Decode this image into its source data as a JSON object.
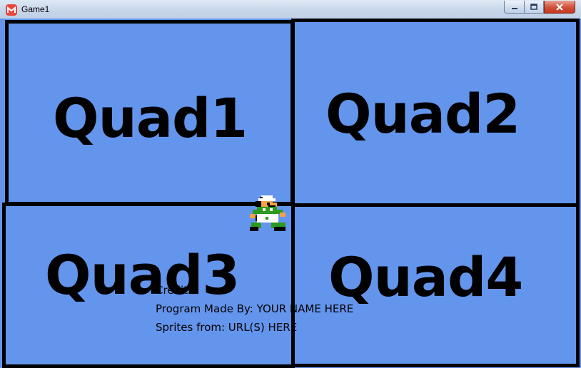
{
  "window": {
    "title": "Game1",
    "buttons": {
      "minimize": "minimize-icon",
      "maximize": "maximize-icon",
      "close": "close-icon"
    }
  },
  "game": {
    "background_color": "#6495ed",
    "border_color": "#000000",
    "quads": [
      {
        "label": "Quad1"
      },
      {
        "label": "Quad2"
      },
      {
        "label": "Quad3"
      },
      {
        "label": "Quad4"
      }
    ],
    "sprite": "luigi-sprite-icon",
    "credits": {
      "heading": "Credits",
      "made_by": "Program Made By: YOUR  NAME  HERE",
      "sprites_from": "Sprites from: URL(S) HERE"
    }
  }
}
